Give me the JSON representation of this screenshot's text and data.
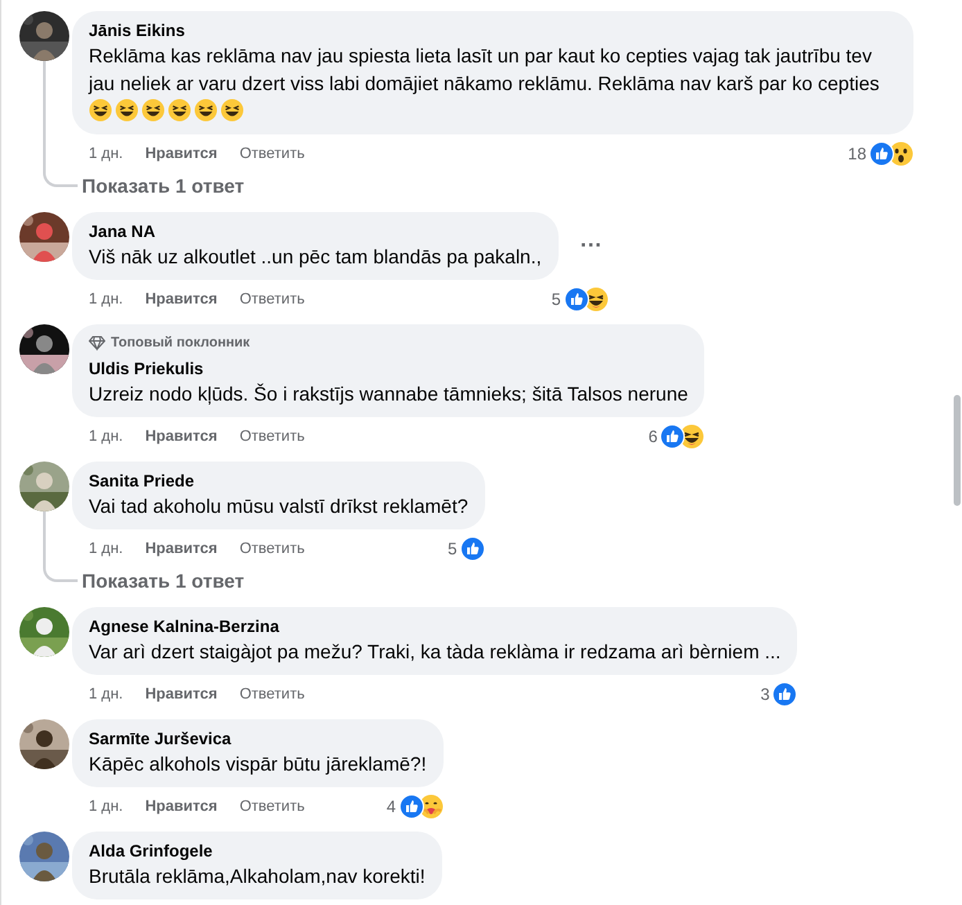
{
  "comments": [
    {
      "name": "Jānis Eikins",
      "text": "Reklāma kas reklāma nav jau spiesta lieta lasīt un par kaut ko cepties vajag tak jautrību tev jau neliek ar varu dzert viss labi domājiet nākamo reklāmu. Reklāma nav karš par ko cepties",
      "emojis": [
        {
          "kind": "laugh"
        },
        {
          "kind": "laugh"
        },
        {
          "kind": "laugh"
        },
        {
          "kind": "laugh"
        },
        {
          "kind": "laugh"
        },
        {
          "kind": "laugh"
        }
      ],
      "time": "1 дн.",
      "like": "Нравится",
      "reply": "Ответить",
      "reaction_count": "18",
      "reactions": [
        {
          "kind": "like"
        },
        {
          "kind": "wow"
        }
      ],
      "replies_link": "Показать 1 ответ"
    },
    {
      "name": "Jana NA",
      "text": "Viš nāk uz alkoutlet ..un pēc tam blandās pa pakaln.,",
      "menu": "···",
      "time": "1 дн.",
      "like": "Нравится",
      "reply": "Ответить",
      "reaction_count": "5",
      "reactions": [
        {
          "kind": "like"
        },
        {
          "kind": "haha"
        }
      ]
    },
    {
      "badge": "Топовый поклонник",
      "name": "Uldis Priekulis",
      "text": "Uzreiz nodo kļūds. Šo i rakstījs wannabe tāmnieks; šitā Talsos nerune",
      "time": "1 дн.",
      "like": "Нравится",
      "reply": "Ответить",
      "reaction_count": "6",
      "reactions": [
        {
          "kind": "like"
        },
        {
          "kind": "haha"
        }
      ]
    },
    {
      "name": "Sanita Priede",
      "text": "Vai tad akoholu mūsu valstī drīkst reklamēt?",
      "time": "1 дн.",
      "like": "Нравится",
      "reply": "Ответить",
      "reaction_count": "5",
      "reactions": [
        {
          "kind": "like"
        }
      ],
      "replies_link": "Показать 1 ответ"
    },
    {
      "name": "Agnese Kalnina-Berzina",
      "text": "Var arì dzert staigàjot pa mežu? Traki, ka tàda reklàma ir redzama arì bèrniem ...",
      "time": "1 дн.",
      "like": "Нравится",
      "reply": "Ответить",
      "reaction_count": "3",
      "reactions": [
        {
          "kind": "like"
        }
      ]
    },
    {
      "name": "Sarmīte Jurševica",
      "text": "Kāpēc alkohols vispār būtu jāreklamē?!",
      "time": "1 дн.",
      "like": "Нравится",
      "reply": "Ответить",
      "reaction_count": "4",
      "reactions": [
        {
          "kind": "like"
        },
        {
          "kind": "care"
        }
      ]
    },
    {
      "name": "Alda Grinfogele",
      "text": "Brutāla reklāma,Alkaholam,nav korekti!"
    }
  ]
}
